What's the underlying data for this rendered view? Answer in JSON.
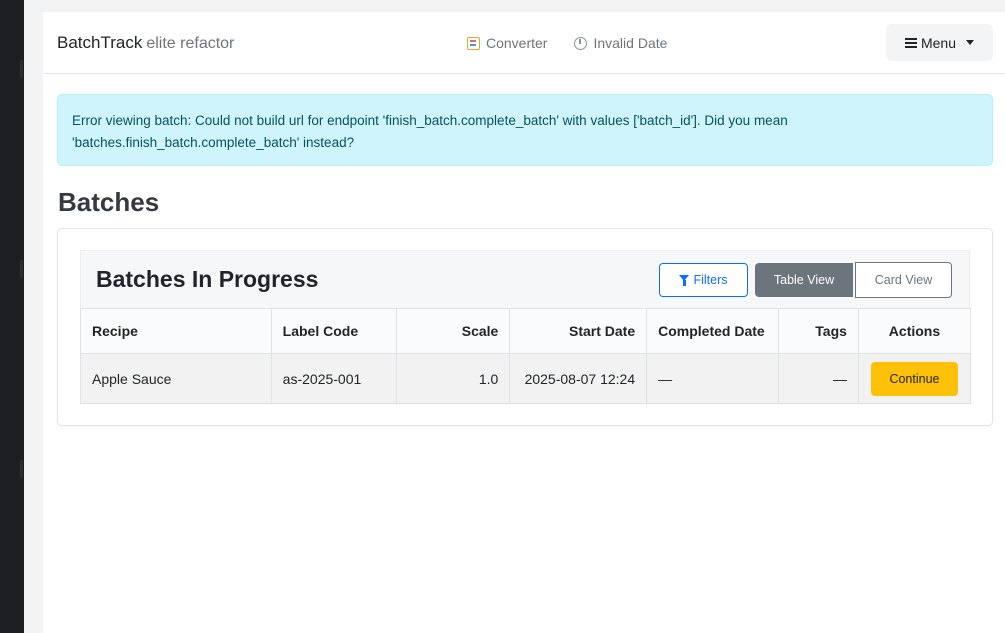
{
  "navbar": {
    "brand": "BatchTrack",
    "brand_sub": "elite refactor",
    "links": [
      {
        "label": "Converter",
        "icon": "converter-icon"
      },
      {
        "label": "Invalid Date",
        "icon": "clock-icon"
      }
    ],
    "menu_label": "Menu"
  },
  "alert": {
    "message": "Error viewing batch: Could not build url for endpoint 'finish_batch.complete_batch' with values ['batch_id']. Did you mean 'batches.finish_batch.complete_batch' instead?",
    "color": "#cff4fc"
  },
  "page": {
    "title": "Batches"
  },
  "card": {
    "title": "Batches In Progress",
    "filters_label": "Filters",
    "table_view_label": "Table View",
    "card_view_label": "Card View"
  },
  "table": {
    "headers": [
      "Recipe",
      "Label Code",
      "Scale",
      "Start Date",
      "Completed Date",
      "Tags",
      "Actions"
    ],
    "rows": [
      {
        "recipe": "Apple Sauce",
        "label_code": "as-2025-001",
        "scale": "1.0",
        "start_date": "2025-08-07 12:24",
        "completed_date": "—",
        "tags": "—",
        "action_label": "Continue"
      }
    ]
  },
  "colors": {
    "primary": "#0d6efd",
    "secondary": "#6c757d",
    "warning": "#ffc107"
  }
}
